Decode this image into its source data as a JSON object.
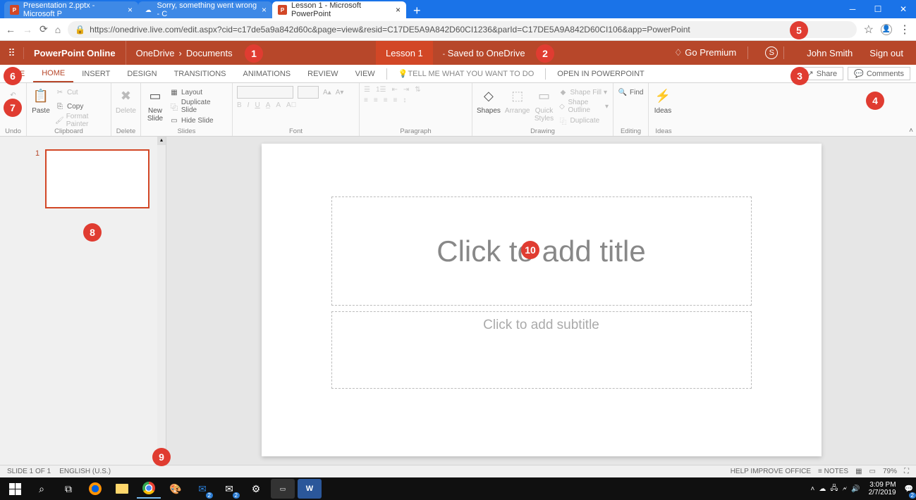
{
  "browser": {
    "tabs": [
      {
        "title": "Presentation 2.pptx - Microsoft P"
      },
      {
        "title": "Sorry, something went wrong - C"
      },
      {
        "title": "Lesson 1 - Microsoft PowerPoint"
      }
    ],
    "url": "https://onedrive.live.com/edit.aspx?cid=c17de5a9a842d60c&page=view&resid=C17DE5A9A842D60CI1236&parId=C17DE5A9A842D60CI106&app=PowerPoint"
  },
  "header": {
    "app_name": "PowerPoint Online",
    "breadcrumb_root": "OneDrive",
    "breadcrumb_folder": "Documents",
    "doc_title": "Lesson 1",
    "saved_status": "Saved to OneDrive",
    "go_premium": "Go Premium",
    "user_name": "John Smith",
    "sign_out": "Sign out"
  },
  "ribbon": {
    "tabs": {
      "file": "FILE",
      "home": "HOME",
      "insert": "INSERT",
      "design": "DESIGN",
      "transitions": "TRANSITIONS",
      "animations": "ANIMATIONS",
      "review": "REVIEW",
      "view": "VIEW",
      "tell_me": "Tell me what you want to do",
      "open_in": "OPEN IN POWERPOINT"
    },
    "share": "Share",
    "comments": "Comments",
    "groups": {
      "undo": {
        "label": "Undo"
      },
      "clipboard": {
        "label": "Clipboard",
        "paste": "Paste",
        "cut": "Cut",
        "copy": "Copy",
        "format_painter": "Format Painter"
      },
      "delete": {
        "label": "Delete",
        "delete": "Delete"
      },
      "slides": {
        "label": "Slides",
        "new_slide": "New\nSlide",
        "layout": "Layout",
        "duplicate": "Duplicate Slide",
        "hide": "Hide Slide"
      },
      "font": {
        "label": "Font"
      },
      "paragraph": {
        "label": "Paragraph"
      },
      "drawing": {
        "label": "Drawing",
        "shapes": "Shapes",
        "arrange": "Arrange",
        "quick_styles": "Quick\nStyles",
        "shape_fill": "Shape Fill",
        "shape_outline": "Shape Outline",
        "duplicate": "Duplicate"
      },
      "editing": {
        "label": "Editing",
        "find": "Find"
      },
      "ideas": {
        "label": "Ideas",
        "ideas": "Ideas"
      }
    }
  },
  "slide": {
    "thumb_number": "1",
    "title_placeholder": "Click to add title",
    "subtitle_placeholder": "Click to add subtitle"
  },
  "status": {
    "slide_count": "SLIDE 1 OF 1",
    "language": "ENGLISH (U.S.)",
    "help": "HELP IMPROVE OFFICE",
    "notes": "NOTES",
    "zoom": "79%"
  },
  "taskbar": {
    "time": "3:09 PM",
    "date": "2/7/2019"
  },
  "callouts": {
    "1": "1",
    "2": "2",
    "3": "3",
    "4": "4",
    "5": "5",
    "6": "6",
    "7": "7",
    "8": "8",
    "9": "9",
    "10": "10"
  }
}
